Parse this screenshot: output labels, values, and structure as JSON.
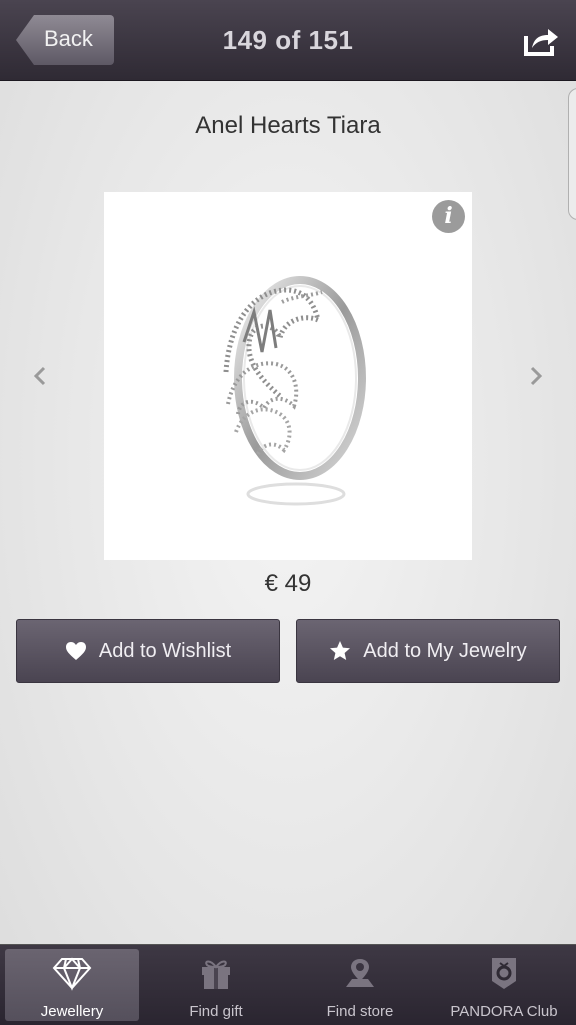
{
  "header": {
    "back_label": "Back",
    "page_counter": "149 of 151"
  },
  "product": {
    "title": "Anel Hearts Tiara",
    "price": "€ 49"
  },
  "actions": {
    "wishlist_label": "Add to Wishlist",
    "my_jewelry_label": "Add to My Jewelry"
  },
  "tabs": [
    {
      "label": "Jewellery",
      "icon": "diamond-icon",
      "active": true
    },
    {
      "label": "Find gift",
      "icon": "gift-icon",
      "active": false
    },
    {
      "label": "Find store",
      "icon": "store-pin-icon",
      "active": false
    },
    {
      "label": "PANDORA Club",
      "icon": "pandora-club-icon",
      "active": false
    }
  ],
  "colors": {
    "bar_dark": "#2f2a34",
    "button": "#5a5460",
    "background": "#e8e8e8"
  }
}
